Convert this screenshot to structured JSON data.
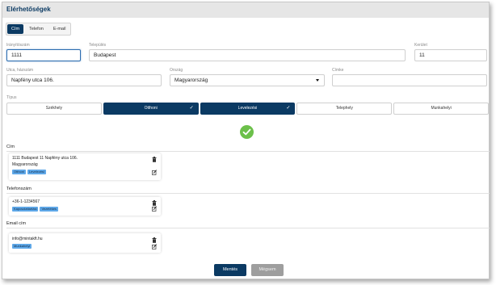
{
  "header": {
    "title": "Elérhetőségek"
  },
  "tabs": [
    {
      "label": "Cím"
    },
    {
      "label": "Telefon"
    },
    {
      "label": "E-mail"
    }
  ],
  "fields": {
    "zip": {
      "label": "Irányítószám",
      "value": "1111"
    },
    "city": {
      "label": "Település",
      "value": "Budapest"
    },
    "district": {
      "label": "Kerület",
      "value": "11"
    },
    "street": {
      "label": "Utca, házszám",
      "value": "Napfény utca 106."
    },
    "country": {
      "label": "Ország",
      "value": "Magyarország"
    },
    "tag": {
      "label": "Címke",
      "value": ""
    }
  },
  "type_section": {
    "label": "Típus",
    "options": [
      {
        "label": "Székhely",
        "selected": false
      },
      {
        "label": "Otthoni",
        "selected": true
      },
      {
        "label": "Levelezési",
        "selected": true
      },
      {
        "label": "Telephely",
        "selected": false
      },
      {
        "label": "Munkahelyi",
        "selected": false
      }
    ]
  },
  "address_section": {
    "title": "Cím",
    "card": {
      "line1": "1111 Budapest 11 Napfény utca 106.",
      "line2": "Magyarország",
      "badges": [
        "Otthoni",
        "Levelezési"
      ]
    }
  },
  "phone_section": {
    "title": "Telefonszám",
    "card": {
      "line1": "+36-1-1234567",
      "badges": [
        "Kapcsolattartási",
        "Vezetékes"
      ]
    }
  },
  "email_section": {
    "title": "Email cím",
    "card": {
      "line1": "info@mintakft.hu",
      "badges": [
        "Munkahelyi"
      ]
    }
  },
  "buttons": {
    "save": "Mentés",
    "cancel": "Mégsem"
  },
  "colors": {
    "primary": "#0b3a63",
    "success": "#6cc04a",
    "badge": "#5fa8e8"
  }
}
